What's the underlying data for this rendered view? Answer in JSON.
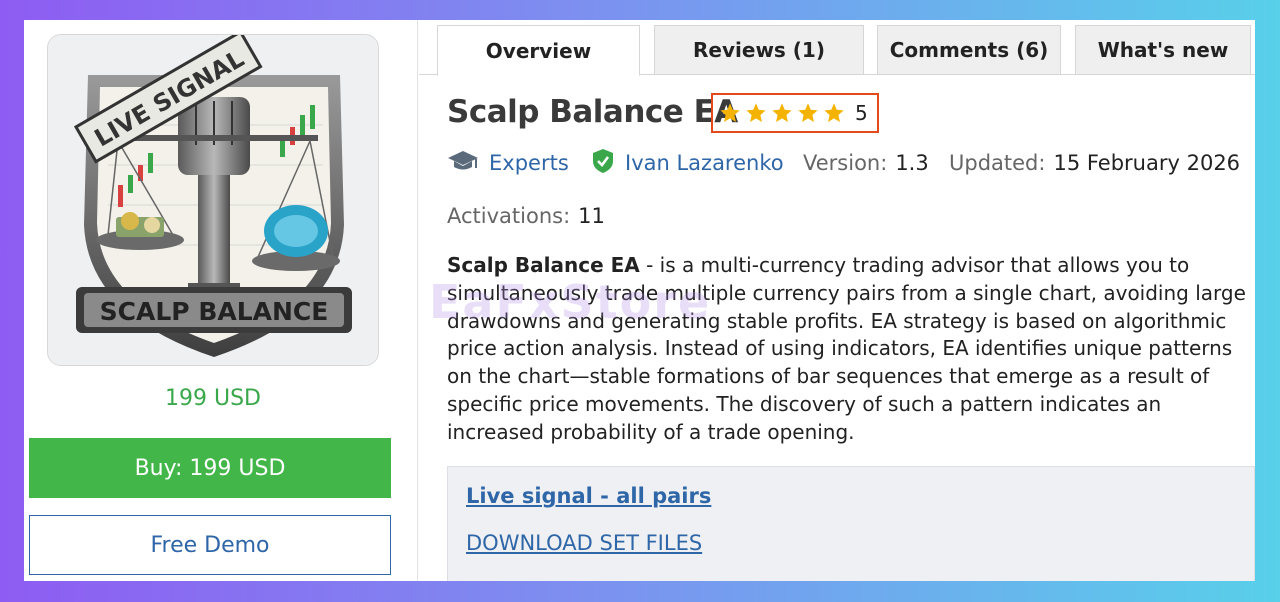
{
  "product": {
    "image_banner_top": "LIVE SIGNAL",
    "image_banner_bottom": "SCALP BALANCE",
    "price": "199 USD",
    "buy_label": "Buy: 199 USD",
    "demo_label": "Free Demo"
  },
  "tabs": [
    {
      "label": "Overview",
      "active": true
    },
    {
      "label": "Reviews (1)",
      "active": false
    },
    {
      "label": "Comments (6)",
      "active": false
    },
    {
      "label": "What's new",
      "active": false
    }
  ],
  "main": {
    "title": "Scalp Balance EA",
    "rating": "5",
    "rating_stars": 5,
    "category": "Experts",
    "author": "Ivan Lazarenko",
    "version_label": "Version:",
    "version": "1.3",
    "updated_label": "Updated:",
    "updated": "15 February 2026",
    "activations_label": "Activations:",
    "activations": "11",
    "desc_bold": "Scalp Balance EA",
    "desc_rest": " - is a multi-currency trading advisor that allows you to simultaneously trade multiple currency pairs from a single chart, avoiding large drawdowns and generating stable profits. EA strategy is based on algorithmic price action analysis. Instead of using indicators, EA identifies unique patterns on the chart—stable formations of bar sequences that emerge as a result of specific price movements. The discovery of such a pattern indicates an increased probability of a trade opening.",
    "link_live_signal": "Live signal - all pairs",
    "link_download": "DOWNLOAD SET FILES"
  },
  "watermark": "EaFxStore",
  "colors": {
    "accent_link": "#2f66a8",
    "buy_green": "#43b649",
    "price_green": "#3aa84a",
    "rating_border": "#e24a1b",
    "star": "#f5b301"
  }
}
